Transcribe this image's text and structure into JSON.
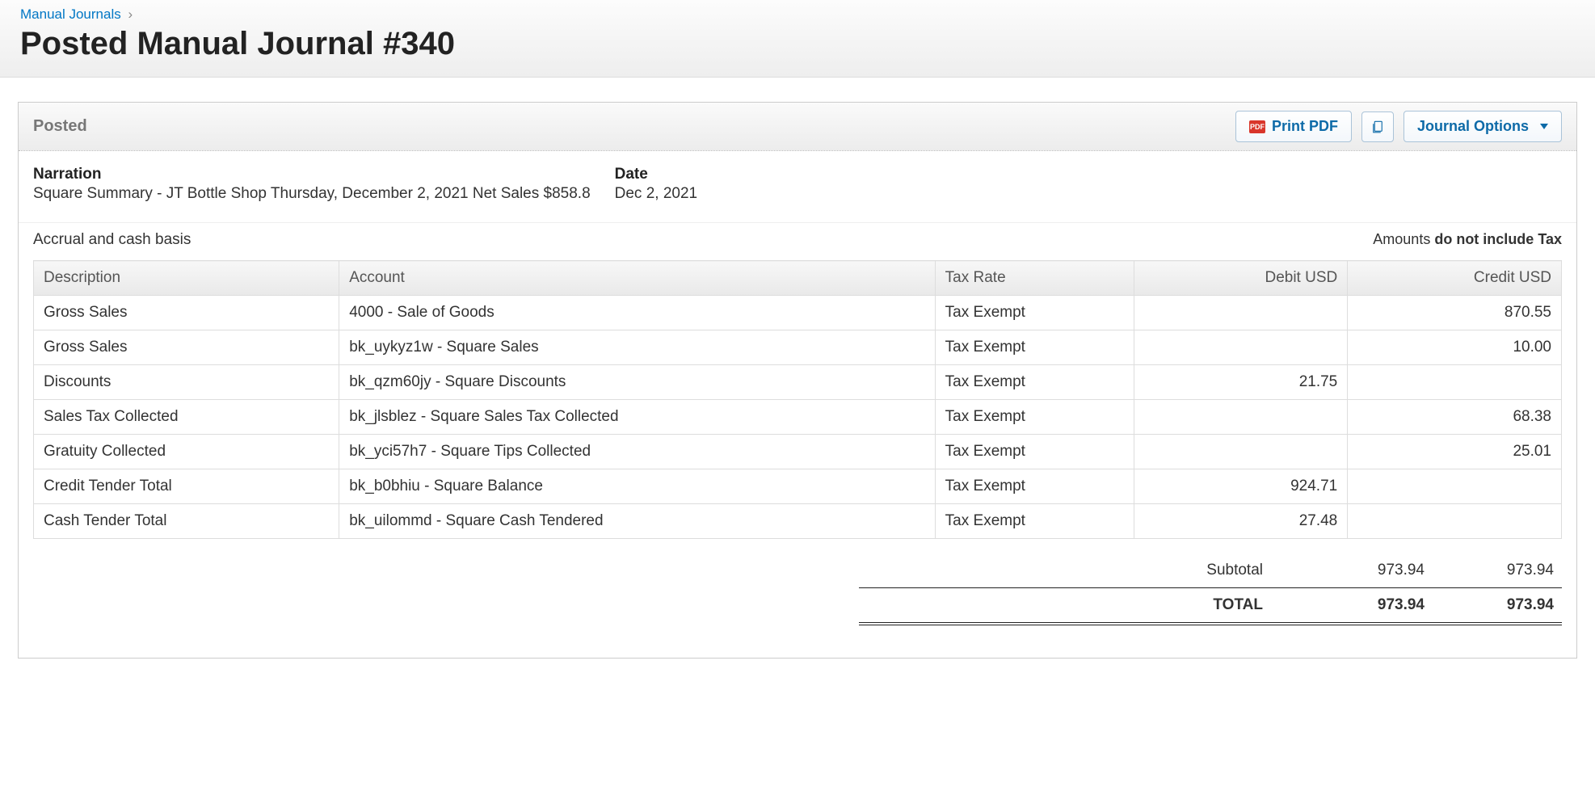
{
  "breadcrumb": {
    "link_label": "Manual Journals",
    "separator": "›"
  },
  "page_title": "Posted Manual Journal #340",
  "card": {
    "status": "Posted",
    "buttons": {
      "print_pdf": "Print PDF",
      "pdf_badge": "PDF",
      "journal_options": "Journal Options"
    }
  },
  "meta": {
    "narration_label": "Narration",
    "narration_value": "Square Summary - JT Bottle Shop Thursday, December 2, 2021 Net Sales $858.8",
    "date_label": "Date",
    "date_value": "Dec 2, 2021"
  },
  "basis": {
    "text": "Accrual and cash basis",
    "tax_prefix": "Amounts ",
    "tax_bold": "do not include Tax"
  },
  "columns": {
    "description": "Description",
    "account": "Account",
    "tax_rate": "Tax Rate",
    "debit": "Debit USD",
    "credit": "Credit USD"
  },
  "rows": [
    {
      "description": "Gross Sales",
      "account": "4000 - Sale of Goods",
      "tax_rate": "Tax Exempt",
      "debit": "",
      "credit": "870.55"
    },
    {
      "description": "Gross Sales",
      "account": "bk_uykyz1w - Square Sales",
      "tax_rate": "Tax Exempt",
      "debit": "",
      "credit": "10.00"
    },
    {
      "description": "Discounts",
      "account": "bk_qzm60jy - Square Discounts",
      "tax_rate": "Tax Exempt",
      "debit": "21.75",
      "credit": ""
    },
    {
      "description": "Sales Tax Collected",
      "account": "bk_jlsblez - Square Sales Tax Collected",
      "tax_rate": "Tax Exempt",
      "debit": "",
      "credit": "68.38"
    },
    {
      "description": "Gratuity Collected",
      "account": "bk_yci57h7 - Square Tips Collected",
      "tax_rate": "Tax Exempt",
      "debit": "",
      "credit": "25.01"
    },
    {
      "description": "Credit Tender Total",
      "account": "bk_b0bhiu - Square Balance",
      "tax_rate": "Tax Exempt",
      "debit": "924.71",
      "credit": ""
    },
    {
      "description": "Cash Tender Total",
      "account": "bk_uilommd - Square Cash Tendered",
      "tax_rate": "Tax Exempt",
      "debit": "27.48",
      "credit": ""
    }
  ],
  "totals": {
    "subtotal_label": "Subtotal",
    "subtotal_debit": "973.94",
    "subtotal_credit": "973.94",
    "total_label": "TOTAL",
    "total_debit": "973.94",
    "total_credit": "973.94"
  }
}
